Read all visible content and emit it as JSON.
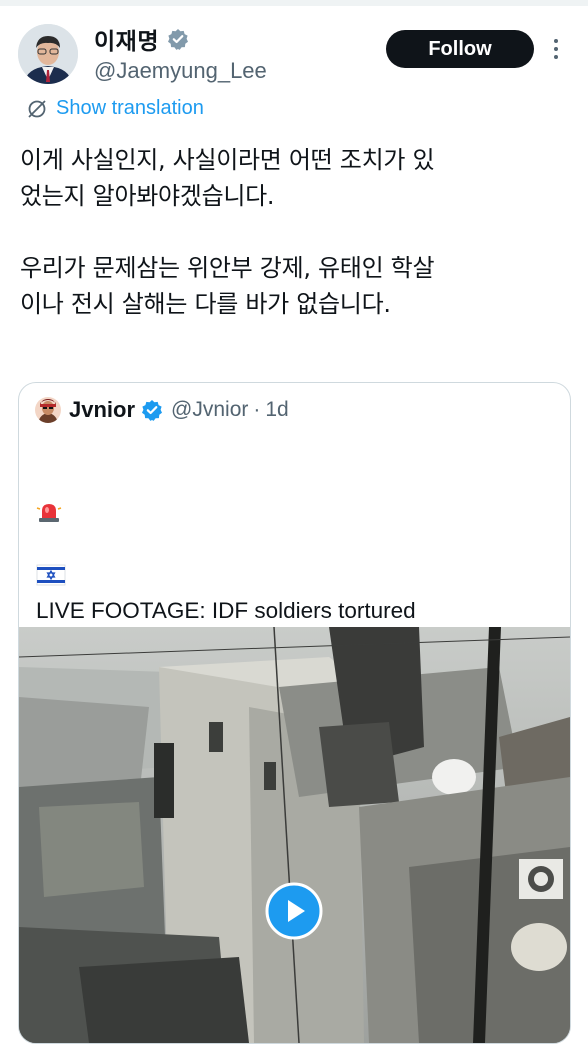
{
  "author": {
    "display_name": "이재명",
    "handle": "@Jaemyung_Lee",
    "verified_icon": "gray-verified-badge-icon"
  },
  "actions": {
    "follow_label": "Follow",
    "more_icon": "more-vertical-icon",
    "translate_label": "Show translation",
    "translate_icon": "translate-icon"
  },
  "tweet": {
    "text": "이게 사실인지, 사실이라면 어떤 조치가 있\n었는지 알아봐야겠습니다.\n\n우리가 문제삼는 위안부 강제, 유태인 학살\n이나 전시 살해는 다를 바가 없습니다."
  },
  "quoted_tweet": {
    "display_name": "Jvnior",
    "handle": "@Jvnior",
    "separator": "·",
    "time": "1d",
    "verified_icon": "blue-verified-badge-icon",
    "emojis": [
      "rotating-light-emoji",
      "israel-flag-emoji"
    ],
    "text": "LIVE FOOTAGE: IDF soldiers tortured\na Palestinian kid and threw him off a roof.\n\nThey call themselves “the most moral\narmy.”",
    "media": {
      "type": "video",
      "play_icon": "play-icon"
    }
  },
  "colors": {
    "accent_blue": "#1d9bf0",
    "text_primary": "#0f1419",
    "text_secondary": "#536471",
    "border": "#cfd9de",
    "button_bg": "#0f1419"
  }
}
